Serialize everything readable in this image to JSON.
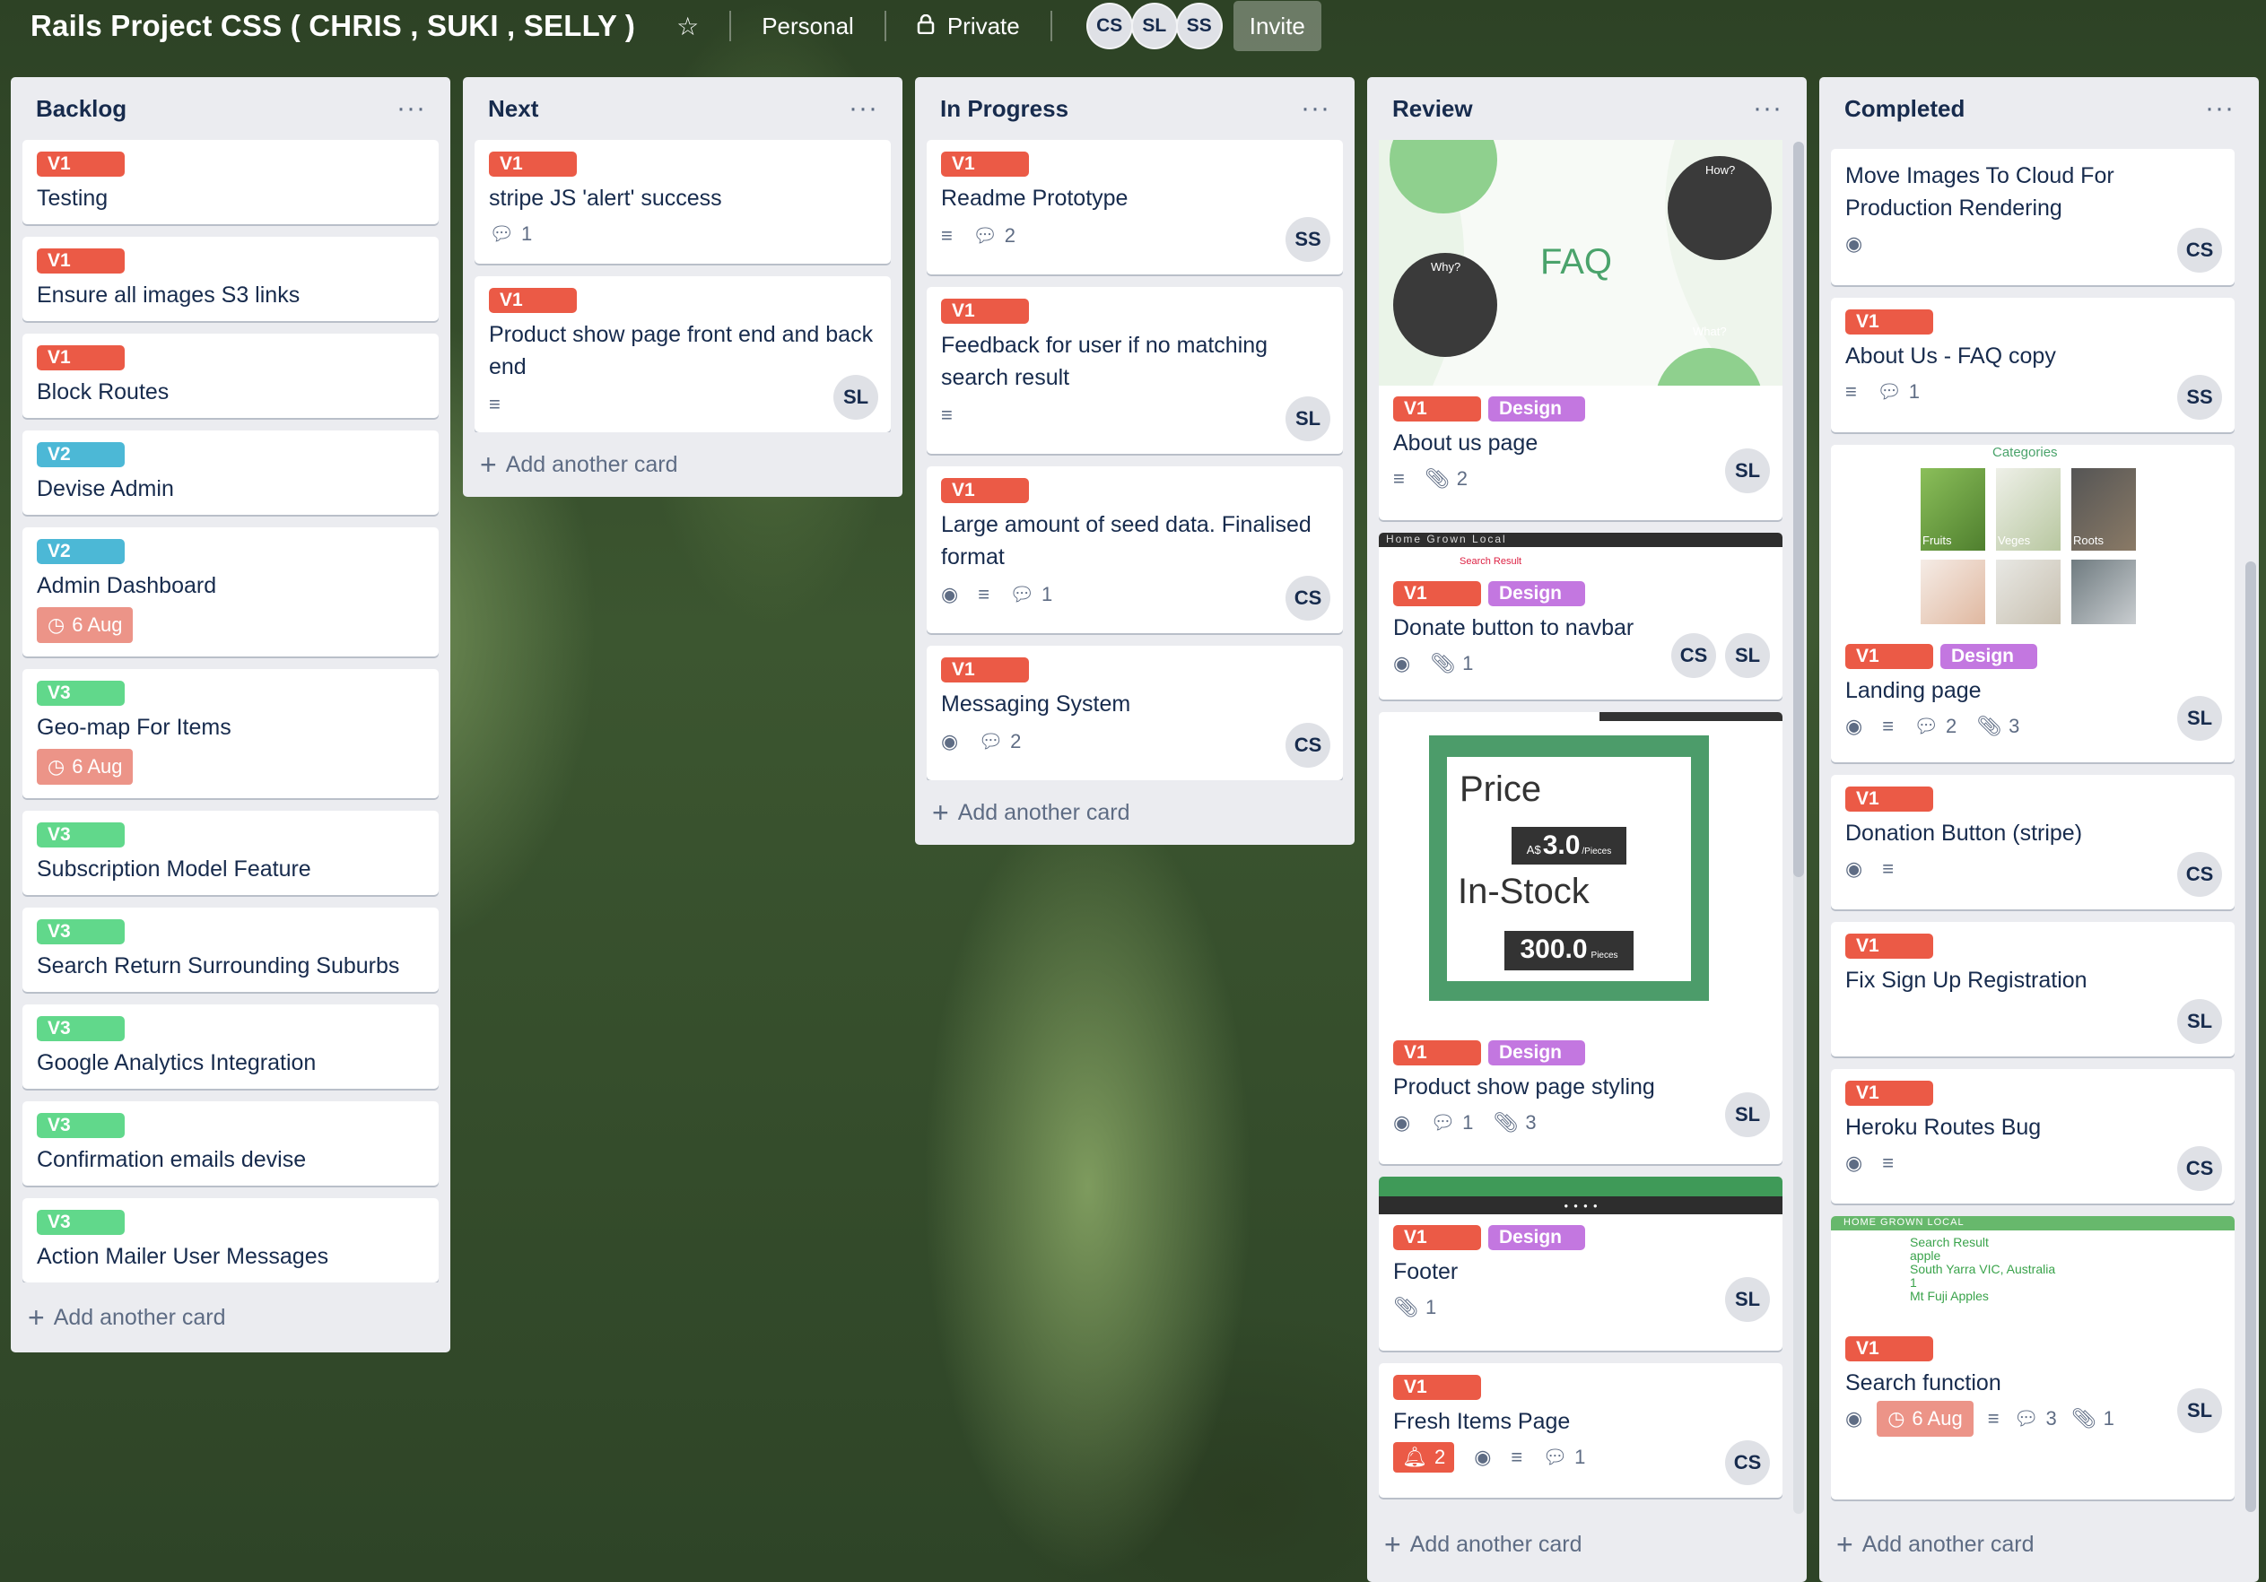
{
  "board": {
    "title": "Rails Project CSS ( CHRIS , SUKI , SELLY )",
    "workspace": "Personal",
    "visibility": "Private",
    "members": [
      "CS",
      "SL",
      "SS"
    ],
    "invite_label": "Invite"
  },
  "colors": {
    "red": "#eb5a46",
    "blue": "#4cb8d6",
    "green": "#61d88b",
    "purple": "#c377e0",
    "due": "#ec9488"
  },
  "add_card_label": "Add another card",
  "lists": {
    "backlog": {
      "title": "Backlog",
      "menu": "···",
      "cards": [
        {
          "label": "V1",
          "title": "Testing"
        },
        {
          "label": "V1",
          "title": "Ensure all images S3 links"
        },
        {
          "label": "V1",
          "title": "Block Routes"
        },
        {
          "label": "V2",
          "title": "Devise Admin"
        },
        {
          "label": "V2",
          "title": "Admin Dashboard",
          "due": "6 Aug"
        },
        {
          "label": "V3",
          "title": "Geo-map For Items",
          "due": "6 Aug"
        },
        {
          "label": "V3",
          "title": "Subscription Model Feature"
        },
        {
          "label": "V3",
          "title": "Search Return Surrounding Suburbs"
        },
        {
          "label": "V3",
          "title": "Google Analytics Integration"
        },
        {
          "label": "V3",
          "title": "Confirmation emails devise"
        },
        {
          "label": "V3",
          "title": "Action Mailer User Messages"
        }
      ]
    },
    "next": {
      "title": "Next",
      "menu": "···",
      "cards": [
        {
          "label": "V1",
          "title": "stripe JS 'alert' success",
          "comments": "1"
        },
        {
          "label": "V1",
          "title": "Product show page front end and back end",
          "member": "SL"
        }
      ]
    },
    "inprogress": {
      "title": "In Progress",
      "menu": "···",
      "cards": [
        {
          "label": "V1",
          "title": "Readme Prototype",
          "comments": "2",
          "member": "SS"
        },
        {
          "label": "V1",
          "title": "Feedback for user if no matching search result",
          "member": "SL"
        },
        {
          "label": "V1",
          "title": "Large amount of seed data. Finalised format",
          "comments": "1",
          "member": "CS"
        },
        {
          "label": "V1",
          "title": "Messaging System",
          "comments": "2",
          "member": "CS"
        }
      ]
    },
    "review": {
      "title": "Review",
      "menu": "···",
      "cards": [
        {
          "label": "V1",
          "label2": "Design",
          "title": "About us page",
          "attachments": "2",
          "member": "SL",
          "cover": {
            "heading": "FAQ",
            "how": "How?",
            "why": "Why?",
            "what": "What?"
          }
        },
        {
          "label": "V1",
          "label2": "Design",
          "title": "Donate button to navbar",
          "attachments": "1",
          "members": [
            "CS",
            "SL"
          ],
          "cover": {
            "brand": "Home Grown Local",
            "subtitle": "Search Result"
          }
        },
        {
          "label": "V1",
          "label2": "Design",
          "title": "Product show page styling",
          "comments": "1",
          "attachments": "3",
          "member": "SL",
          "cover": {
            "price_label": "Price",
            "price_currency": "A$",
            "price_value": "3.0",
            "price_unit": "/Pieces",
            "stock_label": "In-Stock",
            "stock_value": "300.0",
            "stock_unit": "Pieces"
          }
        },
        {
          "label": "V1",
          "label2": "Design",
          "title": "Footer",
          "attachments": "1",
          "member": "SL"
        },
        {
          "label": "V1",
          "title": "Fresh Items Page",
          "notifications": "2",
          "comments": "1",
          "member": "CS"
        }
      ]
    },
    "completed": {
      "title": "Completed",
      "menu": "···",
      "cards": [
        {
          "title": "Move Images To Cloud For Production Rendering",
          "member": "CS"
        },
        {
          "label": "V1",
          "title": "About Us - FAQ copy",
          "comments": "1",
          "member": "SS"
        },
        {
          "label": "V1",
          "label2": "Design",
          "title": "Landing page",
          "comments": "2",
          "attachments": "3",
          "member": "SL",
          "cover": {
            "heading": "Categories",
            "tiles": [
              "Fruits",
              "Veges",
              "Roots"
            ]
          }
        },
        {
          "label": "V1",
          "title": "Donation Button (stripe)",
          "member": "CS"
        },
        {
          "label": "V1",
          "title": "Fix Sign Up Registration",
          "member": "SL"
        },
        {
          "label": "V1",
          "title": "Heroku Routes Bug",
          "member": "CS"
        },
        {
          "label": "V1",
          "title": "Search function",
          "due": "6 Aug",
          "comments": "3",
          "attachments": "1",
          "member": "SL",
          "cover": {
            "brand": "HOME GROWN LOCAL",
            "line1": "Search Result",
            "line2": "apple",
            "line3": "South Yarra VIC, Australia",
            "line4": "1",
            "line5": "Mt Fuji Apples"
          }
        }
      ]
    }
  }
}
